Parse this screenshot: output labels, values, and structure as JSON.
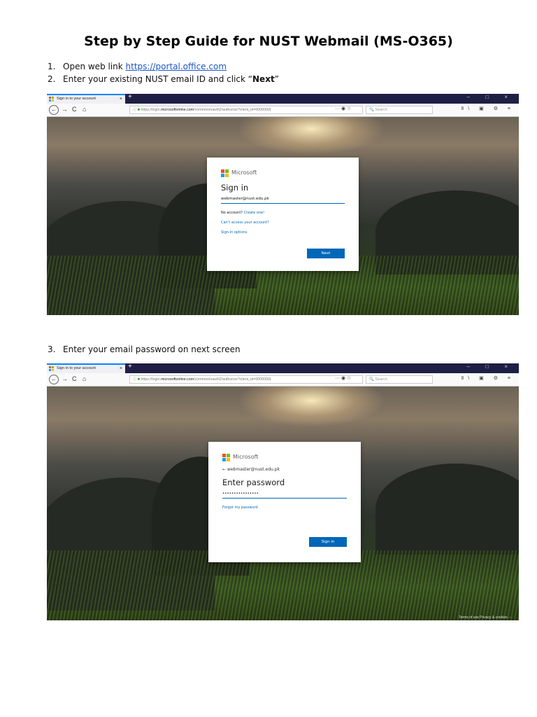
{
  "document": {
    "title": "Step by Step Guide for NUST Webmail (MS-O365)",
    "steps": [
      {
        "number": "1.",
        "text_before": "Open web link ",
        "link": "https://portal.office.com"
      },
      {
        "number": "2.",
        "text_before": "Enter your existing NUST email ID and click “",
        "bold": "Next",
        "text_after": "”"
      },
      {
        "number": "3.",
        "text": "Enter your email password on next screen"
      }
    ]
  },
  "browser": {
    "tab_title": "Sign in to your account",
    "tab_close": "×",
    "new_tab": "+",
    "window_controls": "– □ ×",
    "url_prefix": "https://login.",
    "url_host": "microsoftonline.com",
    "url_rest": "/common/oauth2/authorize?client_id=0000000(",
    "url_actions": "··· ◉ ☆",
    "search_placeholder": "🔍 Search",
    "toolbar_icons": "Ⅱ\\ ▣ ⚙ ≡",
    "nav_back": "←",
    "nav_forward": "→",
    "nav_reload": "C",
    "nav_home": "⌂"
  },
  "signin": {
    "brand": "Microsoft",
    "heading": "Sign in",
    "email_value": "webmaster@nust.edu.pk",
    "no_account": "No account? ",
    "create_one": "Create one!",
    "cant_access": "Can’t access your account?",
    "signin_options": "Sign-in options",
    "next_button": "Next"
  },
  "password": {
    "brand": "Microsoft",
    "back_arrow": "←",
    "account": "webmaster@nust.edu.pk",
    "heading": "Enter password",
    "password_value": "••••••••••••••••",
    "forgot": "Forgot my password",
    "signin_button": "Sign in",
    "footer": "Terms of use   Privacy & cookies   ···"
  },
  "colors": {
    "ms_red": "#f25022",
    "ms_green": "#7fba00",
    "ms_blue": "#00a4ef",
    "ms_yellow": "#ffb900",
    "accent": "#0067b8"
  }
}
